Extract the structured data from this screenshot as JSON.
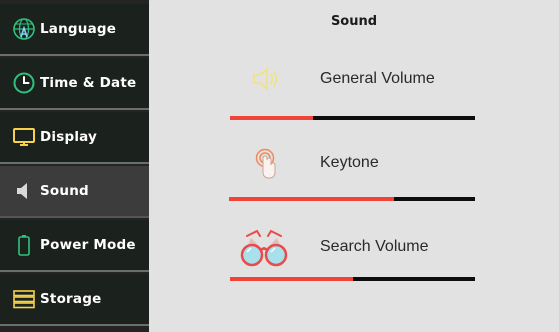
{
  "sidebar": {
    "items": [
      {
        "label": "Language",
        "icon": "globe-a-icon",
        "active": false
      },
      {
        "label": "Time & Date",
        "icon": "clock-icon",
        "active": false
      },
      {
        "label": "Display",
        "icon": "monitor-icon",
        "active": false
      },
      {
        "label": "Sound",
        "icon": "speaker-icon",
        "active": true
      },
      {
        "label": "Power Mode",
        "icon": "battery-icon",
        "active": false
      },
      {
        "label": "Storage",
        "icon": "storage-icon",
        "active": false
      }
    ]
  },
  "main": {
    "title": "Sound",
    "settings": [
      {
        "label": "General Volume",
        "icon": "speaker-volume-icon",
        "level": 0.34
      },
      {
        "label": "Keytone",
        "icon": "touch-finger-icon",
        "level": 0.67
      },
      {
        "label": "Search Volume",
        "icon": "binoculars-icon",
        "level": 0.5
      }
    ]
  },
  "colors": {
    "sidebar_bg": "#1b211c",
    "sidebar_active_bg": "#3c3c3c",
    "accent_green": "#2ec27e",
    "slider_fill": "#f04438",
    "slider_track": "#0d0d0d",
    "speaker_icon": "#f3e27a",
    "touch_icon": "#f08a5d",
    "binocular_icon": "#e94b4b",
    "main_bg": "#e2e2e2"
  }
}
